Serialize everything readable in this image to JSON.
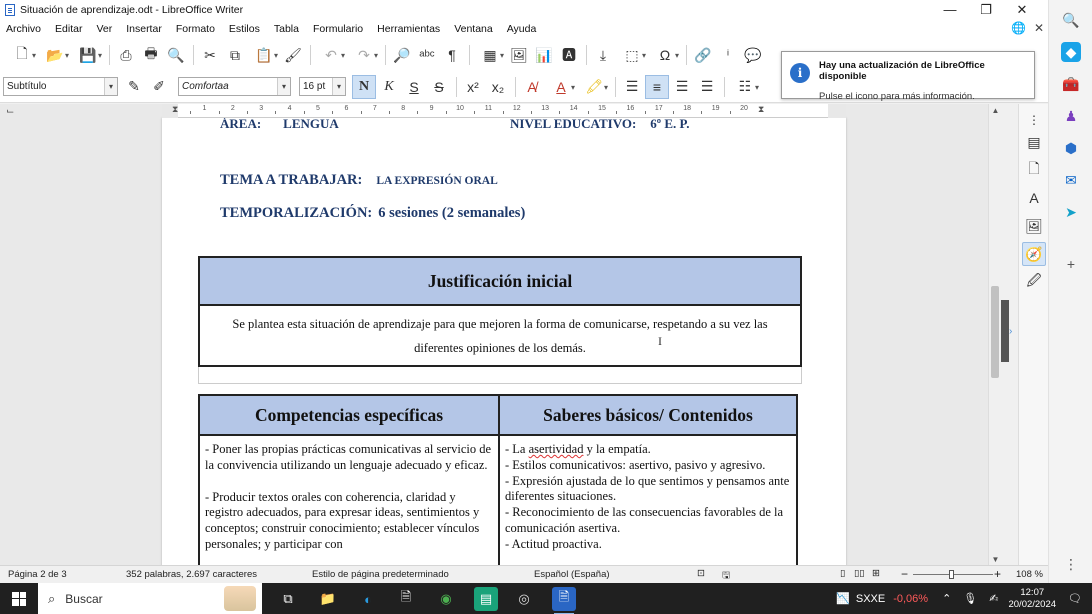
{
  "window": {
    "title": "Situación de aprendizaje.odt - LibreOffice Writer",
    "minimize": "—",
    "maximize": "❐",
    "close": "✕"
  },
  "menu": {
    "items": [
      "Archivo",
      "Editar",
      "Ver",
      "Insertar",
      "Formato",
      "Estilos",
      "Tabla",
      "Formulario",
      "Herramientas",
      "Ventana",
      "Ayuda"
    ]
  },
  "format": {
    "paragraph_style": "Subtítulo",
    "font_name": "Comfortaa",
    "font_size": "16 pt",
    "bold": "N",
    "italic": "K",
    "underline": "S",
    "strike": "S"
  },
  "notification": {
    "title": "Hay una actualización de LibreOffice disponible",
    "text": "Pulse el icono para más información."
  },
  "ruler": {
    "labels": [
      "1",
      "2",
      "3",
      "4",
      "5",
      "6",
      "7",
      "8",
      "9",
      "10",
      "11",
      "12",
      "13",
      "14",
      "15",
      "16",
      "17",
      "18",
      "19",
      "20"
    ]
  },
  "document": {
    "area_label": "ÁREA:",
    "area_value": "LENGUA",
    "nivel_label": "NIVEL EDUCATIVO:",
    "nivel_value": "6º E. P.",
    "tema_label": "TEMA A TRABAJAR:",
    "tema_value": "LA EXPRESIÓN ORAL",
    "temp_label": "TEMPORALIZACIÓN:",
    "temp_value": "6 sesiones (2 semanales)",
    "justificacion_title": "Justificación inicial",
    "justificacion_text": "Se plantea esta situación de aprendizaje para que  mejoren  la forma de comunicarse, respetando  a su vez las diferentes opiniones de los demás.",
    "competencias_title": "Competencias específicas",
    "competencias_p1": "-  Poner las propias prácticas comunicativas al servicio de la convivencia utilizando un lenguaje adecuado y eficaz.",
    "competencias_p2": "- Producir textos orales con coherencia, claridad y registro adecuados, para expresar ideas, sentimientos y conceptos; construir conocimiento; establecer vínculos personales; y participar con",
    "saberes_title": "Saberes básicos/ Contenidos",
    "saberes_items": [
      {
        "pre": "- La ",
        "sq": "asertividad",
        "post": " y la empatía."
      },
      {
        "pre": "- Estilos comunicativos: asertivo, pasivo y agresivo.",
        "sq": "",
        "post": ""
      },
      {
        "pre": "- Expresión ajustada de lo que sentimos y pensamos ante diferentes situaciones.",
        "sq": "",
        "post": ""
      },
      {
        "pre": "- Reconocimiento de las consecuencias favorables de la comunicación asertiva.",
        "sq": "",
        "post": ""
      },
      {
        "pre": "- Actitud proactiva.",
        "sq": "",
        "post": ""
      }
    ]
  },
  "status": {
    "page": "Página 2 de 3",
    "words": "352 palabras, 2.697 caracteres",
    "page_style": "Estilo de página predeterminado",
    "language": "Español (España)",
    "zoom": "108 %",
    "zoom_minus": "−",
    "zoom_plus": "+"
  },
  "taskbar": {
    "search_placeholder": "Buscar",
    "stock_symbol": "SXXE",
    "stock_change": "-0,06%",
    "time": "12:07",
    "date": "20/02/2024"
  },
  "colors": {
    "table_header": "#b4c6e7",
    "heading_text": "#1f3a6b",
    "taskbar": "#202020",
    "stock_negative": "#ff5a5a"
  }
}
